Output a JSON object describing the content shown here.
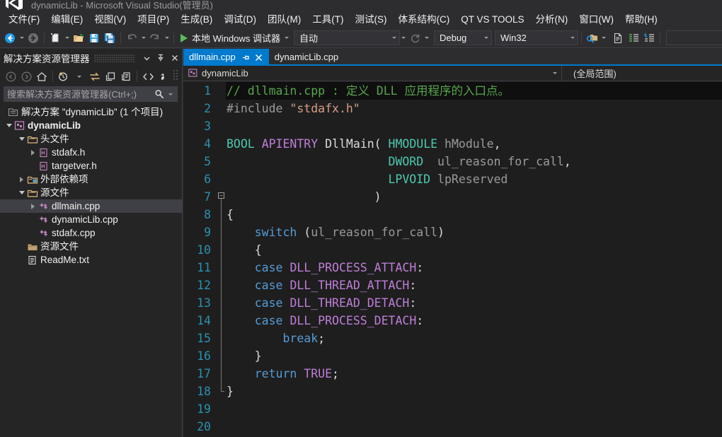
{
  "window": {
    "title": "dynamicLib - Microsoft Visual Studio(管理员)"
  },
  "menu": {
    "items": [
      {
        "label": "文件(F)"
      },
      {
        "label": "编辑(E)"
      },
      {
        "label": "视图(V)"
      },
      {
        "label": "项目(P)"
      },
      {
        "label": "生成(B)"
      },
      {
        "label": "调试(D)"
      },
      {
        "label": "团队(M)"
      },
      {
        "label": "工具(T)"
      },
      {
        "label": "测试(S)"
      },
      {
        "label": "体系结构(C)"
      },
      {
        "label": "QT VS TOOLS"
      },
      {
        "label": "分析(N)"
      },
      {
        "label": "窗口(W)"
      },
      {
        "label": "帮助(H)"
      }
    ]
  },
  "toolbar": {
    "run_label": "本地 Windows 调试器",
    "config_value": "自动",
    "build_config": "Debug",
    "platform": "Win32",
    "find_value": "",
    "icons": [
      "navigate-back-icon",
      "navigate-forward-icon",
      "new-item-icon",
      "open-file-icon",
      "save-icon",
      "save-all-icon",
      "undo-icon",
      "redo-icon",
      "play-icon",
      "refresh-icon",
      "find-in-files-icon",
      "new-file-icon",
      "comment-icon",
      "uncomment-icon"
    ]
  },
  "solution_explorer": {
    "title": "解决方案资源管理器",
    "search_placeholder": "搜索解决方案资源管理器(Ctrl+;)",
    "search_value": "",
    "header_buttons": [
      "chevron-down-icon",
      "pin-icon",
      "close-icon"
    ],
    "toolbar_buttons": [
      "back-icon",
      "forward-icon",
      "home-icon",
      "pending-changes-icon",
      "sync-icon",
      "collapse-all-icon",
      "show-all-files-icon",
      "view-code-icon",
      "properties-icon"
    ],
    "tree": [
      {
        "label": "解决方案 \"dynamicLib\" (1 个项目)",
        "indent": 0,
        "expander": "none",
        "icon": "solution-icon",
        "bold": false,
        "selected": false
      },
      {
        "label": "dynamicLib",
        "indent": 1,
        "expander": "expanded",
        "icon": "project-icon",
        "bold": true,
        "selected": false
      },
      {
        "label": "头文件",
        "indent": 2,
        "expander": "expanded",
        "icon": "folder-icon",
        "bold": false,
        "selected": false
      },
      {
        "label": "stdafx.h",
        "indent": 3,
        "expander": "collapsed",
        "icon": "header-file-icon",
        "bold": false,
        "selected": false
      },
      {
        "label": "targetver.h",
        "indent": 3,
        "expander": "none",
        "icon": "header-file-icon",
        "bold": false,
        "selected": false
      },
      {
        "label": "外部依赖项",
        "indent": 2,
        "expander": "collapsed",
        "icon": "dependencies-icon",
        "bold": false,
        "selected": false
      },
      {
        "label": "源文件",
        "indent": 2,
        "expander": "expanded",
        "icon": "folder-icon",
        "bold": false,
        "selected": false
      },
      {
        "label": "dllmain.cpp",
        "indent": 3,
        "expander": "collapsed",
        "icon": "cpp-file-icon",
        "bold": false,
        "selected": true
      },
      {
        "label": "dynamicLib.cpp",
        "indent": 3,
        "expander": "none",
        "icon": "cpp-file-icon",
        "bold": false,
        "selected": false
      },
      {
        "label": "stdafx.cpp",
        "indent": 3,
        "expander": "none",
        "icon": "cpp-file-icon",
        "bold": false,
        "selected": false
      },
      {
        "label": "资源文件",
        "indent": 2,
        "expander": "none",
        "icon": "folder-icon",
        "bold": false,
        "selected": false
      },
      {
        "label": "ReadMe.txt",
        "indent": 2,
        "expander": "none",
        "icon": "text-file-icon",
        "bold": false,
        "selected": false
      }
    ]
  },
  "editor": {
    "tabs": [
      {
        "label": "dllmain.cpp",
        "active": true
      },
      {
        "label": "dynamicLib.cpp",
        "active": false
      }
    ],
    "navbar": {
      "scope_left": "dynamicLib",
      "scope_right": "(全局范围)"
    },
    "lines": [
      {
        "n": "1",
        "current": true
      },
      {
        "n": "2",
        "current": false
      },
      {
        "n": "3",
        "current": false
      },
      {
        "n": "4",
        "current": false
      },
      {
        "n": "5",
        "current": false
      },
      {
        "n": "6",
        "current": false
      },
      {
        "n": "7",
        "current": false
      },
      {
        "n": "8",
        "current": false
      },
      {
        "n": "9",
        "current": false
      },
      {
        "n": "10",
        "current": false
      },
      {
        "n": "11",
        "current": false
      },
      {
        "n": "12",
        "current": false
      },
      {
        "n": "13",
        "current": false
      },
      {
        "n": "14",
        "current": false
      },
      {
        "n": "15",
        "current": false
      },
      {
        "n": "16",
        "current": false
      },
      {
        "n": "17",
        "current": false
      },
      {
        "n": "18",
        "current": false
      },
      {
        "n": "19",
        "current": false
      },
      {
        "n": "20",
        "current": false
      }
    ],
    "code_text": [
      "// dllmain.cpp : 定义 DLL 应用程序的入口点。",
      "#include \"stdafx.h\"",
      "",
      "BOOL APIENTRY DllMain( HMODULE hModule,",
      "                       DWORD  ul_reason_for_call,",
      "                       LPVOID lpReserved",
      "                     )",
      "{",
      "    switch (ul_reason_for_call)",
      "    {",
      "    case DLL_PROCESS_ATTACH:",
      "    case DLL_THREAD_ATTACH:",
      "    case DLL_THREAD_DETACH:",
      "    case DLL_PROCESS_DETACH:",
      "        break;",
      "    }",
      "    return TRUE;",
      "}",
      "",
      ""
    ]
  },
  "colors": {
    "accent": "#007acc",
    "chrome": "#2d2d30",
    "panel": "#252526",
    "editor_bg": "#1e1e1e",
    "comment": "#57a64a",
    "keyword": "#569cd6",
    "type": "#4ec9b0",
    "macro": "#be7fd8",
    "string": "#d69d85",
    "line_number": "#2b91af"
  }
}
